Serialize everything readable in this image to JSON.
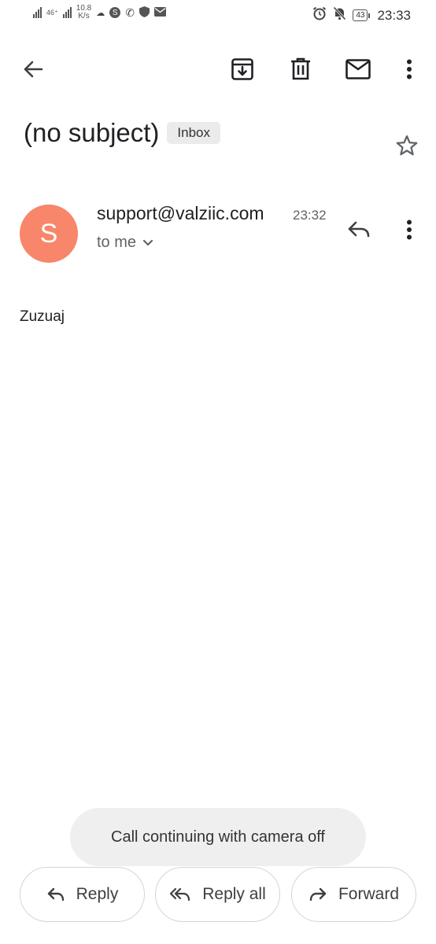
{
  "status_bar": {
    "network_type": "46⁺",
    "net_speed_value": "10.8",
    "net_speed_unit": "K/s",
    "battery": "43",
    "time": "23:33"
  },
  "toolbar": {
    "icons": [
      "back-arrow-icon",
      "archive-icon",
      "delete-icon",
      "mark-unread-icon",
      "more-vert-icon"
    ]
  },
  "email": {
    "subject": "(no subject)",
    "label": "Inbox",
    "sender_initial": "S",
    "avatar_color": "#f8866a",
    "sender": "support@valziic.com",
    "time": "23:32",
    "recipient": "to me",
    "body": "Zuzuaj"
  },
  "toast": {
    "message": "Call continuing with camera off"
  },
  "actions": {
    "reply": "Reply",
    "reply_all": "Reply all",
    "forward": "Forward"
  }
}
